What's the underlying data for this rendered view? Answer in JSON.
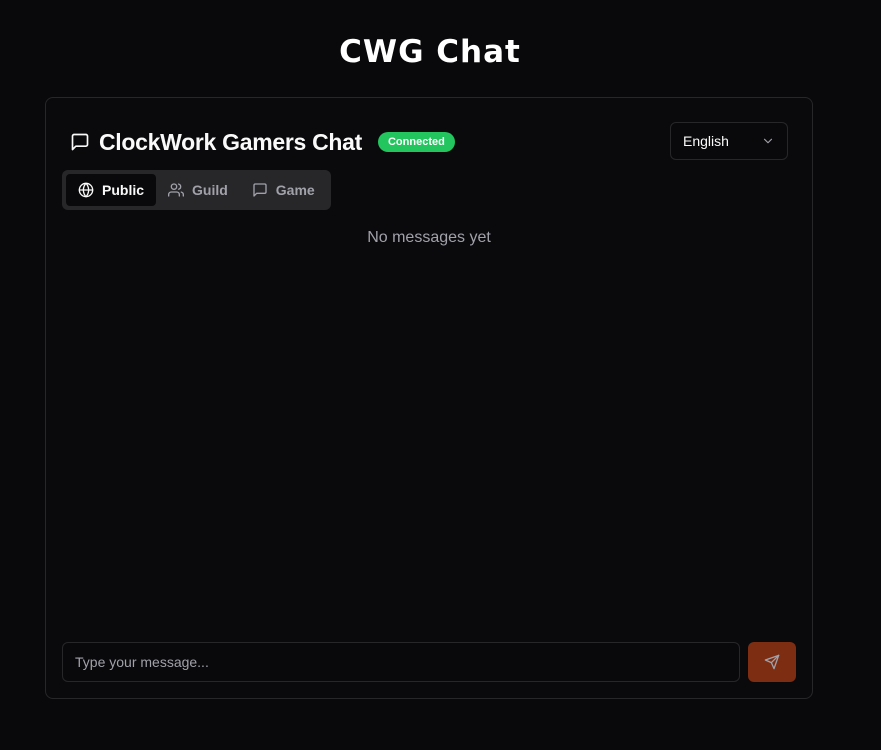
{
  "page": {
    "title": "CWG Chat"
  },
  "chat": {
    "title": "ClockWork Gamers Chat",
    "status": "Connected",
    "title_icon": "message-square-icon"
  },
  "language": {
    "selected": "English",
    "icon": "chevron-down-icon"
  },
  "tabs": [
    {
      "label": "Public",
      "icon": "globe-icon",
      "active": true
    },
    {
      "label": "Guild",
      "icon": "users-icon",
      "active": false
    },
    {
      "label": "Game",
      "icon": "message-square-icon",
      "active": false
    }
  ],
  "messages": {
    "empty_text": "No messages yet"
  },
  "composer": {
    "placeholder": "Type your message...",
    "send_icon": "send-icon"
  },
  "colors": {
    "background": "#09090b",
    "connected": "#22c55e",
    "send_button": "#7c2d12"
  }
}
